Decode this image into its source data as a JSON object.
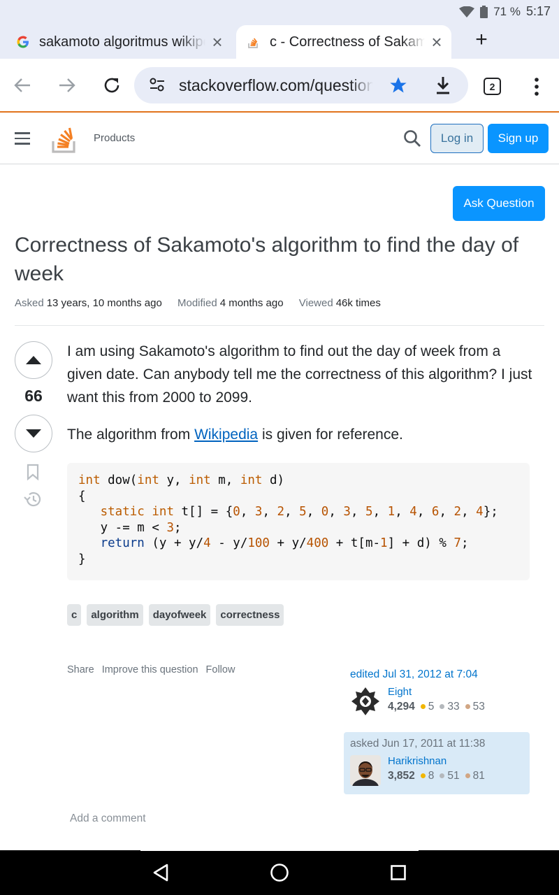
{
  "status": {
    "battery": "71 %",
    "time": "5:17"
  },
  "tabs": [
    {
      "title": "sakamoto algoritmus wikipedia",
      "favicon": "google-icon"
    },
    {
      "title": "c - Correctness of Sakamoto",
      "favicon": "stackoverflow-icon",
      "active": true
    }
  ],
  "toolbar": {
    "url": "stackoverflow.com/questions",
    "tab_count": "2"
  },
  "header": {
    "products": "Products",
    "login": "Log in",
    "signup": "Sign up"
  },
  "question": {
    "ask_button": "Ask Question",
    "title": "Correctness of Sakamoto's algorithm to find the day of week",
    "meta": {
      "asked_label": "Asked",
      "asked_value": "13 years, 10 months ago",
      "modified_label": "Modified",
      "modified_value": "4 months ago",
      "viewed_label": "Viewed",
      "viewed_value": "46k times"
    },
    "score": "66",
    "p1": "I am using Sakamoto's algorithm to find out the day of week from a given date. Can anybody tell me the correctness of this algorithm? I just want this from 2000 to 2099.",
    "p2_before": "The algorithm from ",
    "p2_link": "Wikipedia",
    "p2_after": " is given for reference.",
    "tags": [
      "c",
      "algorithm",
      "dayofweek",
      "correctness"
    ],
    "menu": {
      "share": "Share",
      "improve": "Improve this question",
      "follow": "Follow"
    },
    "edited": {
      "time": "edited Jul 31, 2012 at 7:04",
      "user": "Eight",
      "rep": "4,294",
      "gold": "5",
      "silver": "33",
      "bronze": "53"
    },
    "asked": {
      "time": "asked Jun 17, 2011 at 11:38",
      "user": "Harikrishnan",
      "rep": "3,852",
      "gold": "8",
      "silver": "51",
      "bronze": "81"
    },
    "add_comment": "Add a comment"
  },
  "code": {
    "l1": [
      "int",
      " dow(",
      "int",
      " y, ",
      "int",
      " m, ",
      "int",
      " d)"
    ],
    "l2": "{",
    "l3": [
      "   ",
      "static",
      " ",
      "int",
      " t[] = {",
      "0",
      ", ",
      "3",
      ", ",
      "2",
      ", ",
      "5",
      ", ",
      "0",
      ", ",
      "3",
      ", ",
      "5",
      ", ",
      "1",
      ", ",
      "4",
      ", ",
      "6",
      ", ",
      "2",
      ", ",
      "4",
      "};"
    ],
    "l4": [
      "   y -= m < ",
      "3",
      ";"
    ],
    "l5": [
      "   ",
      "return",
      " (y + y/",
      "4",
      " - y/",
      "100",
      " + y/",
      "400",
      " + t[m-",
      "1",
      "] + d) % ",
      "7",
      ";"
    ],
    "l6": "}"
  }
}
